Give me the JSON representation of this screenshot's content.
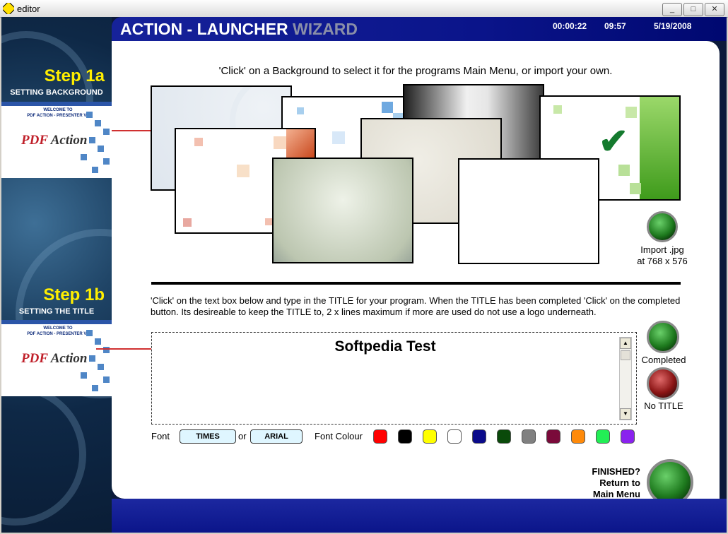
{
  "window": {
    "title": "editor",
    "min_label": "_",
    "max_label": "□",
    "close_label": "✕"
  },
  "header": {
    "title_main": "ACTION - LAUNCHER",
    "title_accent": "WIZARD",
    "timer": "00:00:22",
    "clock": "09:57",
    "date": "5/19/2008"
  },
  "sidebar": {
    "step1a": {
      "title": "Step 1a",
      "subtitle": "SETTING BACKGROUND"
    },
    "step1b": {
      "title": "Step 1b",
      "subtitle": "SETTING THE TITLE"
    },
    "thumb_welcome": "WELCOME TO\nPDF ACTION - PRESENTER V1",
    "thumb_logo_a": "PDF",
    "thumb_logo_b": "Action"
  },
  "backgrounds": {
    "instruction": "'Click' on a Background to select it for the programs Main Menu, or import your own.",
    "import_label_1": "Import .jpg",
    "import_label_2": "at  768 x 576"
  },
  "title_section": {
    "instruction": "'Click' on the text box below and type in the TITLE for your program. When the TITLE has been completed 'Click' on the completed button. Its desireable to keep the TITLE to, 2 x lines maximum if more are used do not use a logo underneath.",
    "title_value": "Softpedia Test",
    "completed_label": "Completed",
    "no_title_label": "No TITLE",
    "font_label": "Font",
    "font_or": "or",
    "font_times": "TIMES",
    "font_arial": "ARIAL",
    "font_colour_label": "Font Colour",
    "colours": [
      "#ff0000",
      "#000000",
      "#ffff00",
      "#ffffff",
      "#0a0a8a",
      "#0a4a0a",
      "#808080",
      "#7a0a3a",
      "#ff8a0a",
      "#22ee55",
      "#8a22ee"
    ]
  },
  "finish": {
    "line1": "FINISHED?",
    "line2": "Return to",
    "line3": "Main Menu"
  }
}
